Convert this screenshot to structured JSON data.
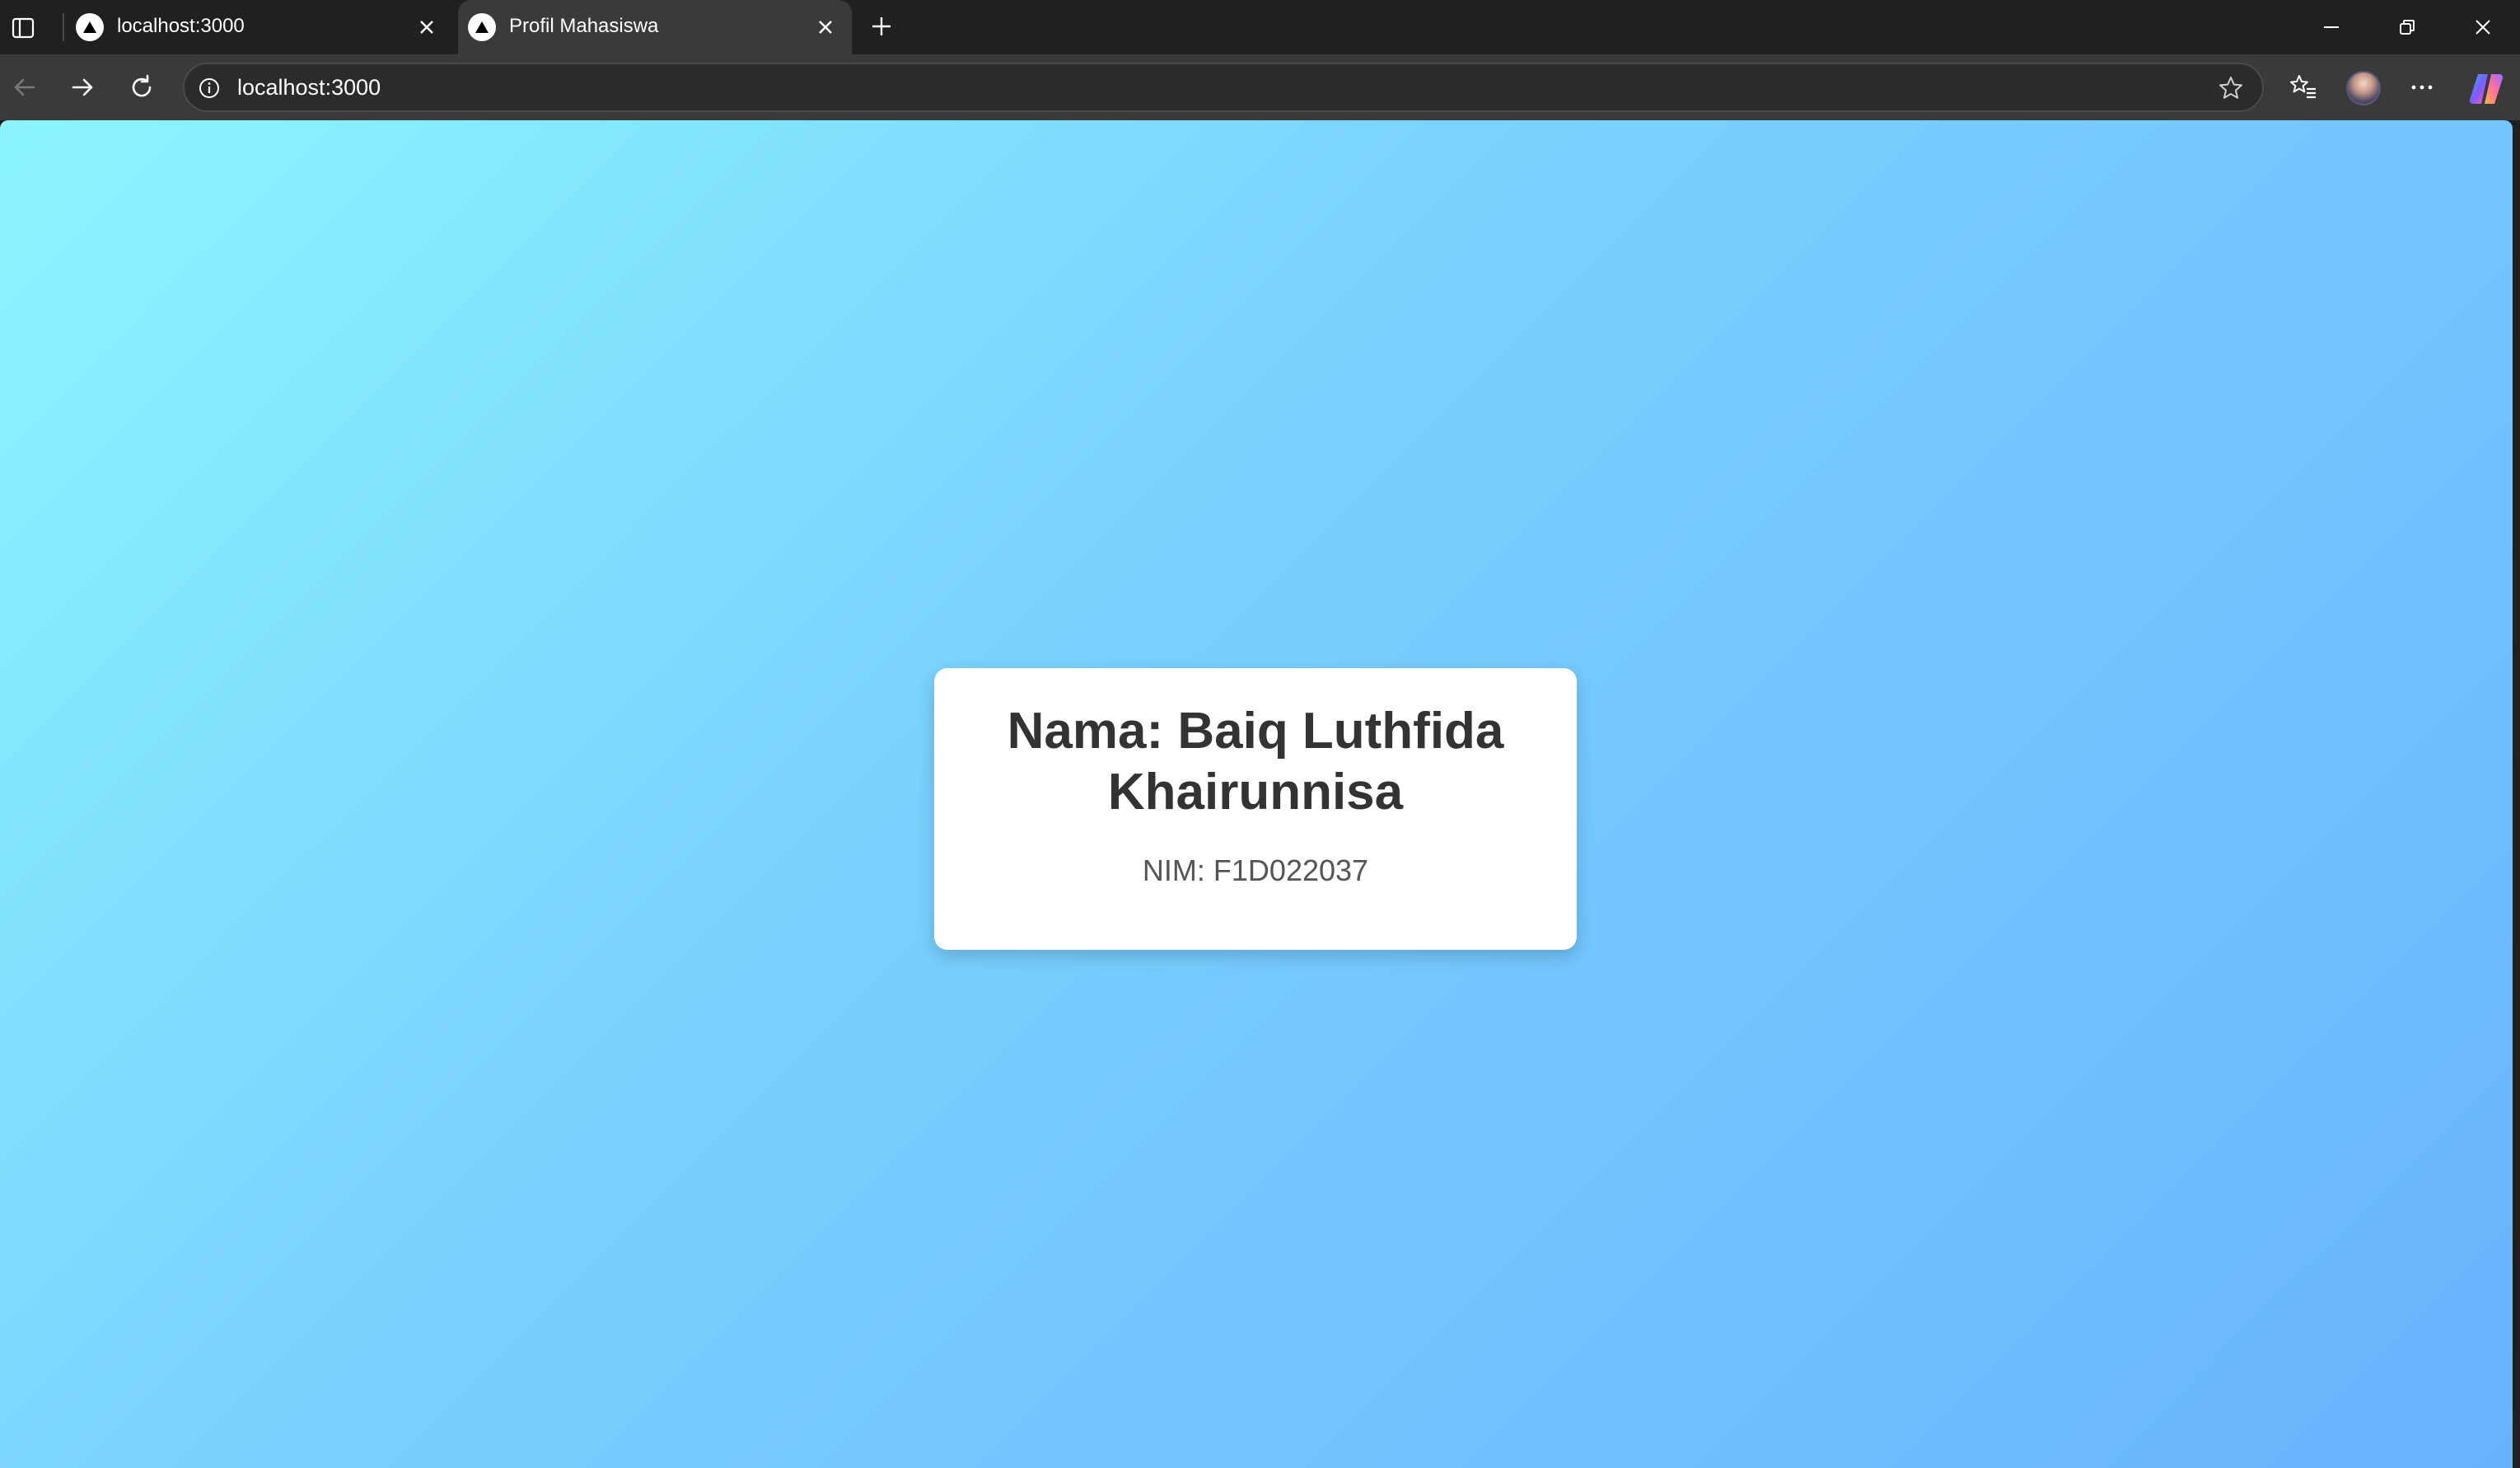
{
  "browser": {
    "tabs": [
      {
        "title": "localhost:3000",
        "active": false
      },
      {
        "title": "Profil Mahasiswa",
        "active": true
      }
    ],
    "address_bar": {
      "value": "localhost:3000"
    }
  },
  "profile_card": {
    "name": "Nama: Baiq Luthfida Khairunnisa",
    "nim": "NIM: F1D022037"
  },
  "icons": {
    "tab_actions": "tab-actions-icon",
    "favicon": "nextjs-triangle-icon",
    "close": "close-icon",
    "new_tab": "plus-icon",
    "minimize": "minimize-icon",
    "restore": "restore-icon",
    "back": "back-arrow-icon",
    "forward": "forward-arrow-icon",
    "refresh": "refresh-icon",
    "site_info": "info-icon",
    "favorite": "star-icon",
    "favorites_list": "favorites-list-icon",
    "more": "more-icon",
    "copilot": "copilot-icon"
  },
  "colors": {
    "gradient_start": "#8df5fe",
    "gradient_end": "#6ab2fe",
    "card_background": "#ffffff",
    "name_text": "#333333",
    "nim_text": "#555555"
  }
}
